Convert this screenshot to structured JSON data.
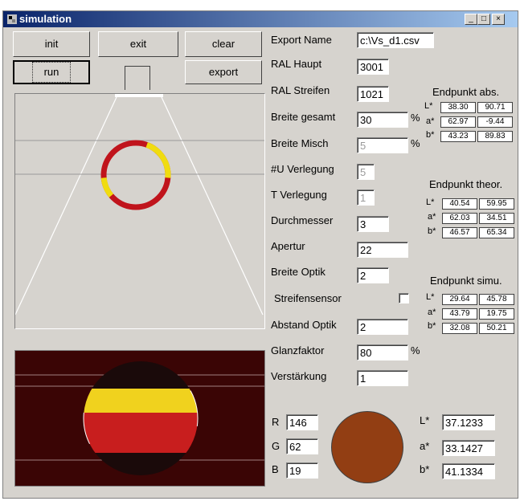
{
  "window": {
    "title": "simulation",
    "minimize_label": "_",
    "maximize_label": "□",
    "close_label": "×"
  },
  "buttons": {
    "init": "init",
    "exit": "exit",
    "clear": "clear",
    "run": "run",
    "export": "export"
  },
  "fields": {
    "export_name": {
      "label": "Export Name",
      "value": "c:\\Vs_d1.csv"
    },
    "ral_haupt": {
      "label": "RAL Haupt",
      "value": "3001"
    },
    "ral_streifen": {
      "label": "RAL Streifen",
      "value": "1021"
    },
    "breite_gesamt": {
      "label": "Breite gesamt",
      "value": "30",
      "unit": "%"
    },
    "breite_misch": {
      "label": "Breite Misch",
      "value": "5",
      "unit": "%"
    },
    "u_verlegung": {
      "label": "#U Verlegung",
      "value": "5"
    },
    "t_verlegung": {
      "label": "T Verlegung",
      "value": "1"
    },
    "durchmesser": {
      "label": "Durchmesser",
      "value": "3"
    },
    "apertur": {
      "label": "Apertur",
      "value": "22"
    },
    "breite_optik": {
      "label": "Breite Optik",
      "value": "2"
    },
    "streifensensor": {
      "label": "Streifensensor",
      "checked": false
    },
    "abstand_optik": {
      "label": "Abstand Optik",
      "value": "2"
    },
    "glanzfaktor": {
      "label": "Glanzfaktor",
      "value": "80",
      "unit": "%"
    },
    "verstaerkung": {
      "label": "Verstärkung",
      "value": "1"
    }
  },
  "endpunkt_abs": {
    "title": "Endpunkt abs.",
    "rows": [
      {
        "label": "L*",
        "v1": "38.30",
        "v2": "90.71"
      },
      {
        "label": "a*",
        "v1": "62.97",
        "v2": "-9.44"
      },
      {
        "label": "b*",
        "v1": "43.23",
        "v2": "89.83"
      }
    ]
  },
  "endpunkt_theor": {
    "title": "Endpunkt theor.",
    "rows": [
      {
        "label": "L*",
        "v1": "40.54",
        "v2": "59.95"
      },
      {
        "label": "a*",
        "v1": "62.03",
        "v2": "34.51"
      },
      {
        "label": "b*",
        "v1": "46.57",
        "v2": "65.34"
      }
    ]
  },
  "endpunkt_simu": {
    "title": "Endpunkt simu.",
    "rows": [
      {
        "label": "L*",
        "v1": "29.64",
        "v2": "45.78"
      },
      {
        "label": "a*",
        "v1": "43.79",
        "v2": "19.75"
      },
      {
        "label": "b*",
        "v1": "32.08",
        "v2": "50.21"
      }
    ]
  },
  "rgb": {
    "r_label": "R",
    "r": "146",
    "g_label": "G",
    "g": "62",
    "b_label": "B",
    "b": "19"
  },
  "lab_result": {
    "l_label": "L*",
    "l": "37.1233",
    "a_label": "a*",
    "a": "33.1427",
    "b_label": "b*",
    "b": "41.1334"
  },
  "colors": {
    "swatch": "#923e13",
    "ring_red": "#c0141c",
    "ring_yellow": "#f0dc10",
    "flag_red": "#c81e1e",
    "flag_yellow": "#f0d21e",
    "flag_dark": "#1a0a0a",
    "panel_bg": "#3a0505"
  }
}
